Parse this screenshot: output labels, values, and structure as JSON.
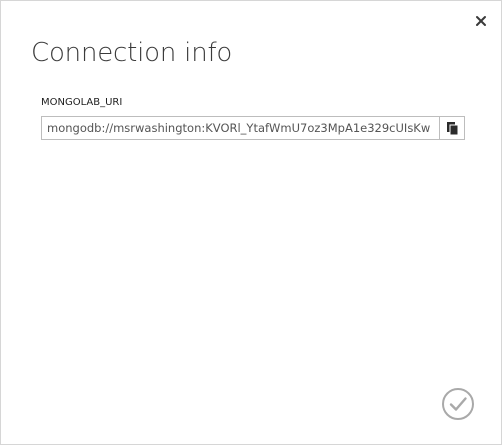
{
  "dialog": {
    "title": "Connection info",
    "close_icon": "close-icon",
    "confirm_icon": "checkmark-circle-icon"
  },
  "field": {
    "label": "MONGOLAB_URI",
    "value": "mongodb://msrwashington:KVORl_YtafWmU7oz3MpA1e329cUIsKw",
    "copy_icon": "copy-icon"
  },
  "colors": {
    "title_text": "#3b3b3b",
    "input_border": "#bdbdbd",
    "confirm_outline": "#a9a9a9"
  }
}
